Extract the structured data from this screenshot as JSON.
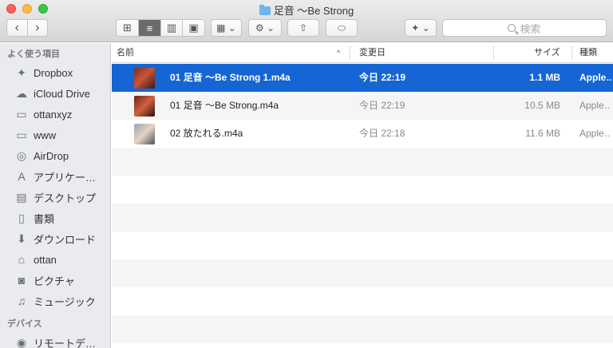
{
  "window": {
    "title": "足音 〜Be Strong"
  },
  "toolbar": {
    "back_glyph": "‹",
    "forward_glyph": "›",
    "view_icon_glyph": "⊞",
    "view_list_glyph": "≡",
    "view_column_glyph": "▥",
    "view_coverflow_glyph": "▣",
    "arrange_glyph": "▦ ⌄",
    "action_glyph": "⚙ ⌄",
    "share_glyph": "⇧",
    "tag_glyph": "⬭",
    "dropbox_glyph": "✦ ⌄",
    "search_placeholder": "検索"
  },
  "sidebar": {
    "favorites_heading": "よく使う項目",
    "favorites": [
      {
        "label": "Dropbox",
        "icon": "dropbox-icon",
        "glyph": "✦"
      },
      {
        "label": "iCloud Drive",
        "icon": "cloud-icon",
        "glyph": "☁"
      },
      {
        "label": "ottanxyz",
        "icon": "folder-icon",
        "glyph": "▭"
      },
      {
        "label": "www",
        "icon": "folder-icon",
        "glyph": "▭"
      },
      {
        "label": "AirDrop",
        "icon": "airdrop-icon",
        "glyph": "◎"
      },
      {
        "label": "アプリケー…",
        "icon": "applications-icon",
        "glyph": "A"
      },
      {
        "label": "デスクトップ",
        "icon": "desktop-icon",
        "glyph": "▤"
      },
      {
        "label": "書類",
        "icon": "documents-icon",
        "glyph": "▯"
      },
      {
        "label": "ダウンロード",
        "icon": "downloads-icon",
        "glyph": "⬇"
      },
      {
        "label": "ottan",
        "icon": "home-icon",
        "glyph": "⌂"
      },
      {
        "label": "ピクチャ",
        "icon": "camera-icon",
        "glyph": "◙"
      },
      {
        "label": "ミュージック",
        "icon": "music-icon",
        "glyph": "♫"
      }
    ],
    "devices_heading": "デバイス",
    "devices": [
      {
        "label": "リモートデ…",
        "icon": "remote-disc-icon",
        "glyph": "◉"
      }
    ]
  },
  "columns": {
    "name": "名前",
    "date": "変更日",
    "size": "サイズ",
    "kind": "種類",
    "sort_indicator": "^"
  },
  "files": [
    {
      "name": "01 足音 〜Be Strong 1.m4a",
      "date": "今日 22:19",
      "size": "1.1 MB",
      "kind": "Apple…",
      "selected": true
    },
    {
      "name": "01 足音 〜Be Strong.m4a",
      "date": "今日 22:19",
      "size": "10.5 MB",
      "kind": "Apple…",
      "selected": false
    },
    {
      "name": "02 放たれる.m4a",
      "date": "今日 22:18",
      "size": "11.6 MB",
      "kind": "Apple…",
      "selected": false
    }
  ],
  "colors": {
    "selection": "#1565d4",
    "sidebar_bg": "#e9ebee"
  }
}
